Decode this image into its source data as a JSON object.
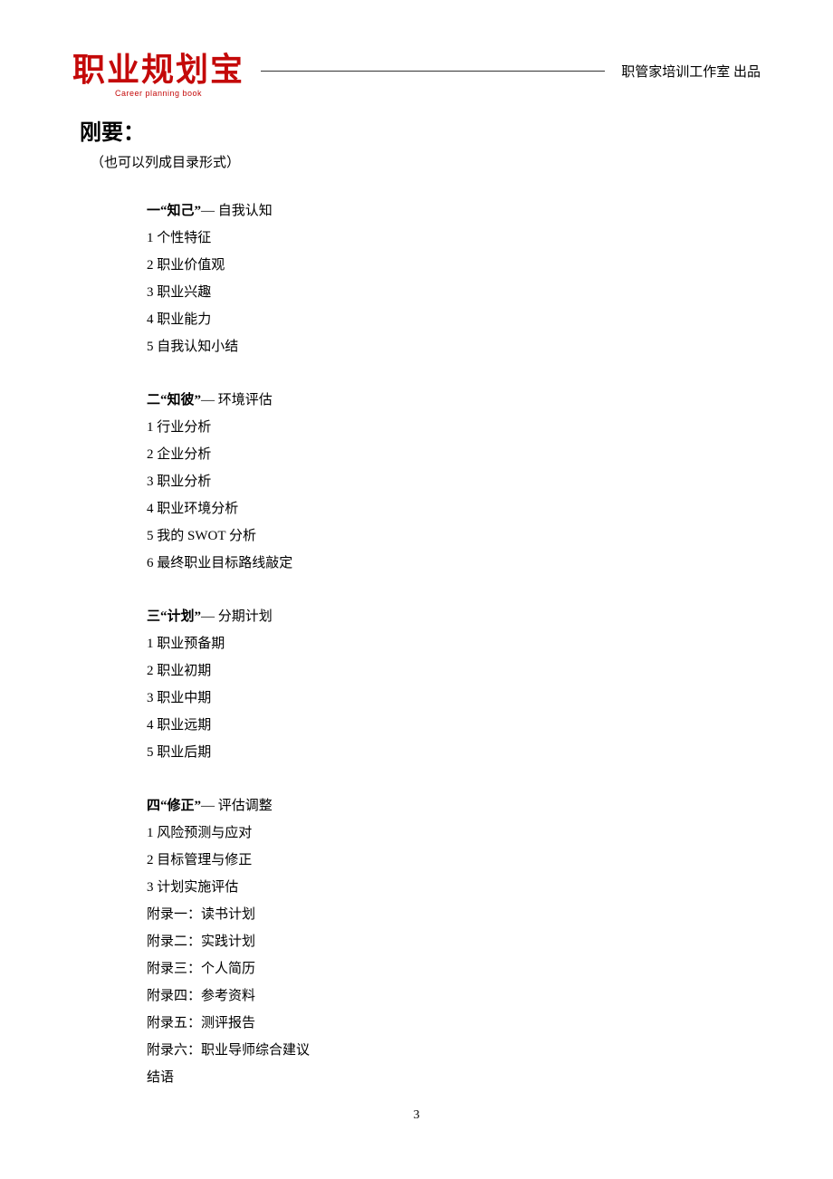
{
  "header": {
    "logo_main": "职业规划宝",
    "logo_sub": "Career planning book",
    "right_text": "职管家培训工作室 出品"
  },
  "title": "刚要：",
  "subtitle": "（也可以列成目录形式）",
  "sections": [
    {
      "heading_bold": "一“知己”",
      "heading_rest": "— 自我认知",
      "items": [
        "1 个性特征",
        "2 职业价值观",
        "3 职业兴趣",
        "4 职业能力",
        "5 自我认知小结"
      ]
    },
    {
      "heading_bold": "二“知彼”",
      "heading_rest": "— 环境评估",
      "items": [
        "1 行业分析",
        "2 企业分析",
        "3 职业分析",
        "4 职业环境分析",
        "5 我的 SWOT 分析",
        "6 最终职业目标路线敲定"
      ]
    },
    {
      "heading_bold": "三“计划”",
      "heading_rest": "— 分期计划",
      "items": [
        "1 职业预备期",
        "2 职业初期",
        "3 职业中期",
        "4 职业远期",
        "5 职业后期"
      ]
    },
    {
      "heading_bold": "四“修正”",
      "heading_rest": "— 评估调整",
      "items": [
        "1 风险预测与应对",
        "2 目标管理与修正",
        "3 计划实施评估",
        "附录一：读书计划",
        "附录二：实践计划",
        "附录三：个人简历",
        "附录四：参考资料",
        "附录五：测评报告",
        "附录六：职业导师综合建议",
        "结语"
      ]
    }
  ],
  "page_number": "3"
}
